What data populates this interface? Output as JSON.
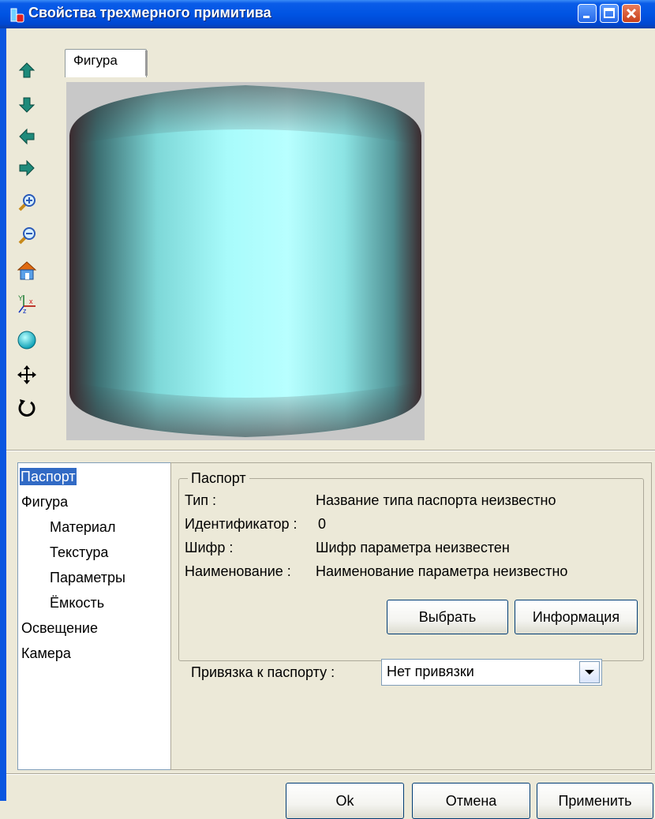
{
  "window": {
    "title": "Свойства трехмерного примитива"
  },
  "toolbar": {
    "tools": [
      {
        "icon": "arrow-up-icon"
      },
      {
        "icon": "arrow-down-icon"
      },
      {
        "icon": "arrow-left-icon"
      },
      {
        "icon": "arrow-right-icon"
      },
      {
        "icon": "zoom-in-icon"
      },
      {
        "icon": "zoom-out-icon"
      },
      {
        "icon": "home-icon"
      },
      {
        "icon": "axes-icon"
      },
      {
        "icon": "sphere-icon"
      },
      {
        "icon": "move-icon"
      },
      {
        "icon": "rotate-icon"
      }
    ]
  },
  "tab": {
    "label": "Фигура"
  },
  "tree": {
    "items": [
      {
        "label": "Паспорт",
        "selected": true
      },
      {
        "label": "Фигура"
      },
      {
        "label": "Материал"
      },
      {
        "label": "Текстура"
      },
      {
        "label": "Параметры"
      },
      {
        "label": "Ёмкость"
      },
      {
        "label": "Освещение"
      },
      {
        "label": "Камера"
      }
    ]
  },
  "passport": {
    "group_title": "Паспорт",
    "type_label": "Тип :",
    "type_value": "Название типа паспорта неизвестно",
    "id_label": "Идентификатор :",
    "id_value": "0",
    "code_label": "Шифр :",
    "code_value": "Шифр параметра неизвестен",
    "name_label": "Наименование :",
    "name_value": "Наименование параметра неизвестно",
    "select_button": "Выбрать",
    "info_button": "Информация"
  },
  "binding": {
    "label": "Привязка к паспорту :",
    "value": "Нет привязки"
  },
  "footer": {
    "ok": "Ok",
    "cancel": "Отмена",
    "apply": "Применить"
  },
  "colors": {
    "title_bar": "#0054e3",
    "cylinder": "#9ff5f5",
    "selection": "#316ac5"
  }
}
